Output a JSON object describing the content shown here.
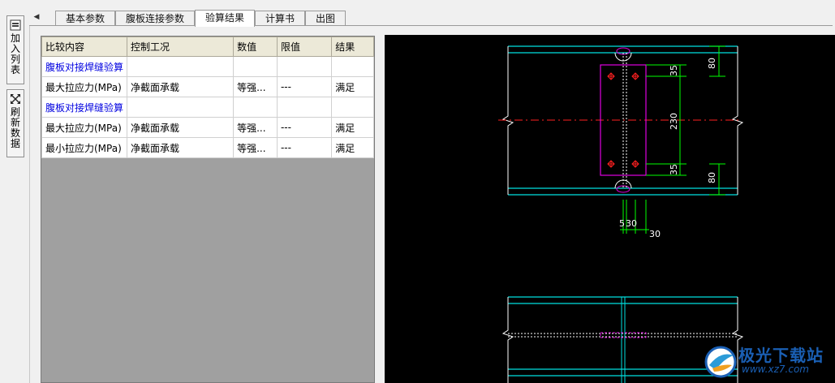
{
  "toolbar": {
    "add_to_list": [
      "加",
      "入",
      "列",
      "表"
    ],
    "refresh_data": [
      "刷",
      "新",
      "数",
      "据"
    ]
  },
  "tabs": [
    {
      "label": "基本参数",
      "active": false
    },
    {
      "label": "腹板连接参数",
      "active": false
    },
    {
      "label": "验算结果",
      "active": true
    },
    {
      "label": "计算书",
      "active": false
    },
    {
      "label": "出图",
      "active": false
    }
  ],
  "table": {
    "headers": [
      "比较内容",
      "控制工况",
      "数值",
      "限值",
      "结果"
    ],
    "rows": [
      {
        "type": "section",
        "cells": [
          "腹板对接焊缝验算",
          "",
          "",
          "",
          ""
        ]
      },
      {
        "type": "data",
        "cells": [
          "最大拉应力(MPa)",
          "净截面承载",
          "等强...",
          "---",
          "满足"
        ]
      },
      {
        "type": "section",
        "cells": [
          "腹板对接焊缝验算",
          "",
          "",
          "",
          ""
        ]
      },
      {
        "type": "data",
        "cells": [
          "最大拉应力(MPa)",
          "净截面承载",
          "等强...",
          "---",
          "满足"
        ]
      },
      {
        "type": "data",
        "cells": [
          "最小拉应力(MPa)",
          "净截面承载",
          "等强...",
          "---",
          "满足"
        ]
      }
    ]
  },
  "drawing": {
    "dims": {
      "top_flange": "80",
      "bolt_edge_top": "35",
      "bolt_spacing": "230",
      "bolt_edge_bottom": "35",
      "bottom_flange": "80",
      "gap_left": "5",
      "gap_mid": "30",
      "gap_right": "30"
    },
    "colors": {
      "beam": "#00e0e0",
      "plate": "#e000e0",
      "dimension": "#00ff00",
      "centerline": "#ff2020",
      "weld": "#ffffff"
    }
  },
  "watermark": {
    "text": "极光下载站",
    "url": "www.xz7.com"
  }
}
